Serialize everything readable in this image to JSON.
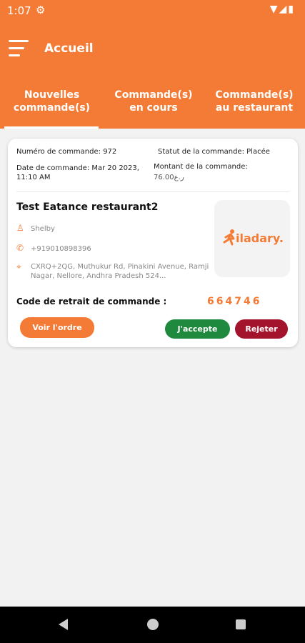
{
  "status_bar": {
    "time": "1:07"
  },
  "app": {
    "title": "Accueil"
  },
  "tabs": [
    {
      "line1": "Nouvelles",
      "line2": "commande(s)"
    },
    {
      "line1": "Commande(s)",
      "line2": "en cours"
    },
    {
      "line1": "Commande(s)",
      "line2": "au restaurant"
    }
  ],
  "order": {
    "number_text": "Numéro de commande: 972",
    "status_text": "Statut de la commande: Placée",
    "date_text": "Date de commande: Mar 20 2023, 11:10 AM",
    "amount_label": "Montant de la commande:",
    "amount_value": "ر.ع76.00",
    "restaurant_name": "Test Eatance restaurant2",
    "customer_name": "Shelby",
    "phone": "+919010898396",
    "address": "CXRQ+2QG, Muthukur Rd, Pinakini Avenue, Ramji Nagar, Nellore, Andhra Pradesh 524...",
    "logo_text": "iladary.",
    "pickup_label": "Code de retrait de commande :",
    "pickup_code": "664746"
  },
  "actions": {
    "view_label": "Voir l'ordre",
    "accept_label": "J'accepte",
    "reject_label": "Rejeter"
  },
  "icons": {
    "settings": "gear-icon",
    "wifi": "wifi-icon",
    "signal": "signal-icon",
    "battery": "battery-icon",
    "menu": "hamburger-menu-icon",
    "user": "person-icon",
    "phone": "phone-icon",
    "location": "location-pin-icon"
  },
  "colors": {
    "brand": "#f47b35",
    "accept": "#1f8a3e",
    "reject": "#a3132b",
    "background": "#f2f2f2"
  }
}
